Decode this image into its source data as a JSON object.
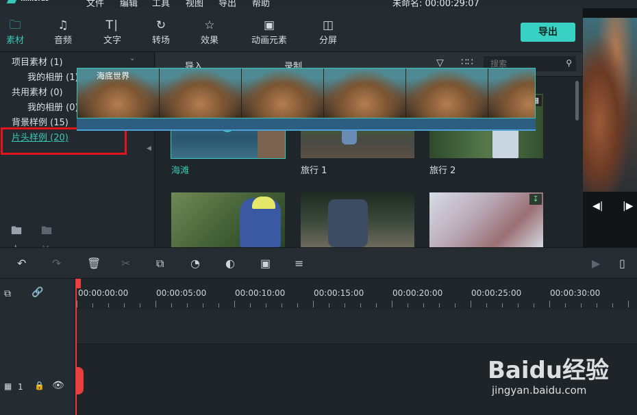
{
  "titlebar": {
    "logo": "filmora9",
    "menus": [
      "文件",
      "编辑",
      "工具",
      "视图",
      "导出",
      "帮助"
    ],
    "project": "未命名: 00:00:29:07"
  },
  "tabs": [
    {
      "label": "素材",
      "icon": "folder-icon",
      "active": true
    },
    {
      "label": "音频",
      "icon": "music-note-icon",
      "active": false
    },
    {
      "label": "文字",
      "icon": "text-icon",
      "active": false
    },
    {
      "label": "转场",
      "icon": "transition-icon",
      "active": false
    },
    {
      "label": "效果",
      "icon": "effects-icon",
      "active": false
    },
    {
      "label": "动画元素",
      "icon": "image-icon",
      "active": false
    },
    {
      "label": "分屏",
      "icon": "split-screen-icon",
      "active": false
    }
  ],
  "export_label": "导出",
  "left_panel": {
    "items": [
      {
        "label": "项目素材 (1)",
        "expandable": true
      },
      {
        "label": "我的相册 (1)",
        "expandable": false
      },
      {
        "label": "共用素材 (0)",
        "expandable": true
      },
      {
        "label": "我的相册 (0)",
        "expandable": false
      },
      {
        "label": "背景样例 (15)",
        "expandable": false
      },
      {
        "label": "片头样例 (20)",
        "expandable": false,
        "highlighted": true
      }
    ]
  },
  "media_toolbar": {
    "import_label": "导入",
    "record_label": "录制",
    "search_placeholder": "搜索"
  },
  "media": [
    {
      "label": "海滩",
      "selected": true
    },
    {
      "label": "旅行 1",
      "selected": false
    },
    {
      "label": "旅行 2",
      "selected": false
    },
    {
      "label": "",
      "selected": false
    },
    {
      "label": "",
      "selected": false
    },
    {
      "label": "",
      "selected": false
    }
  ],
  "timeline": {
    "timecodes": [
      "00:00:00:00",
      "00:00:05:00",
      "00:00:10:00",
      "00:00:15:00",
      "00:00:20:00",
      "00:00:25:00",
      "00:00:30:00"
    ],
    "clip_title": "海底世界",
    "track_number": "1"
  },
  "watermark": {
    "brand": "Baidu经验",
    "url": "jingyan.baidu.com"
  },
  "colors": {
    "accent": "#38c6b6",
    "highlight_box": "#e3141c",
    "playhead": "#e8403f"
  }
}
